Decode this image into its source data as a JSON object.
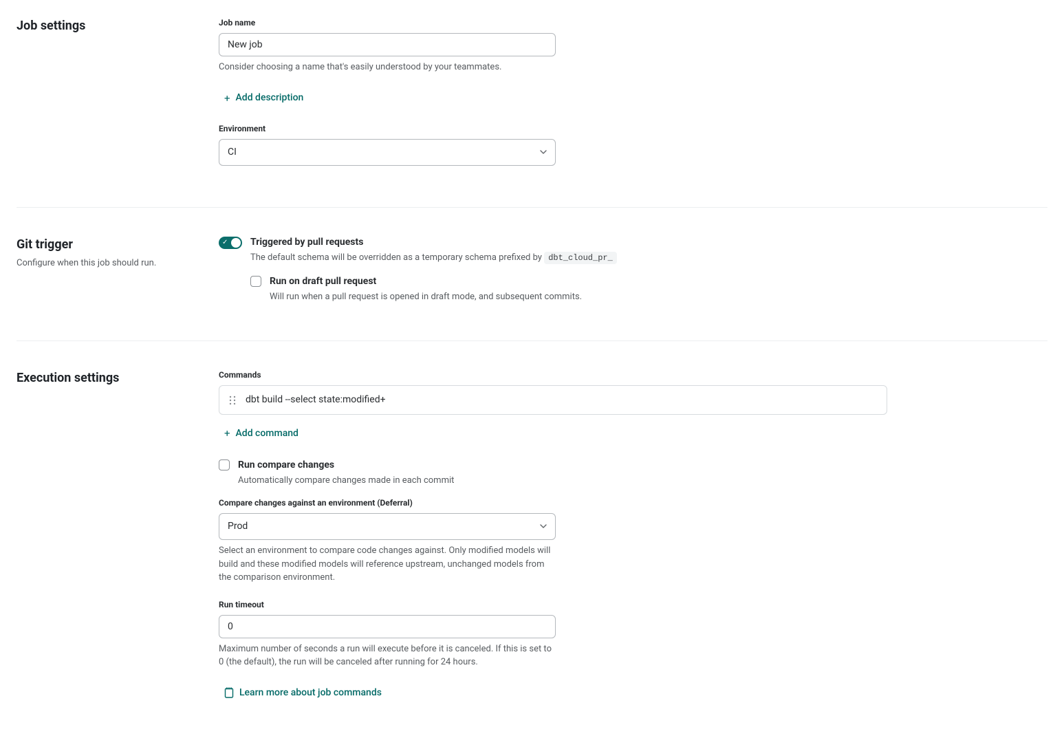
{
  "accent": "#046a67",
  "job_settings": {
    "title": "Job settings",
    "job_name": {
      "label": "Job name",
      "value": "New job",
      "help": "Consider choosing a name that's easily understood by your teammates."
    },
    "add_description_label": "Add description",
    "environment": {
      "label": "Environment",
      "value": "CI"
    }
  },
  "git_trigger": {
    "title": "Git trigger",
    "subtitle": "Configure when this job should run.",
    "triggered_by_pr": {
      "label": "Triggered by pull requests",
      "desc_prefix": "The default schema will be overridden as a temporary schema prefixed by ",
      "schema_prefix": "dbt_cloud_pr_"
    },
    "run_on_draft": {
      "label": "Run on draft pull request",
      "desc": "Will run when a pull request is opened in draft mode, and subsequent commits."
    }
  },
  "execution": {
    "title": "Execution settings",
    "commands_label": "Commands",
    "commands": [
      "dbt build --select state:modified+"
    ],
    "add_command_label": "Add command",
    "run_compare": {
      "label": "Run compare changes",
      "desc": "Automatically compare changes made in each commit"
    },
    "deferral": {
      "label": "Compare changes against an environment (Deferral)",
      "value": "Prod",
      "help": "Select an environment to compare code changes against. Only modified models will build and these modified models will reference upstream, unchanged models from the comparison environment."
    },
    "run_timeout": {
      "label": "Run timeout",
      "value": "0",
      "help": "Maximum number of seconds a run will execute before it is canceled. If this is set to 0 (the default), the run will be canceled after running for 24 hours."
    },
    "learn_more_label": "Learn more about job commands"
  }
}
